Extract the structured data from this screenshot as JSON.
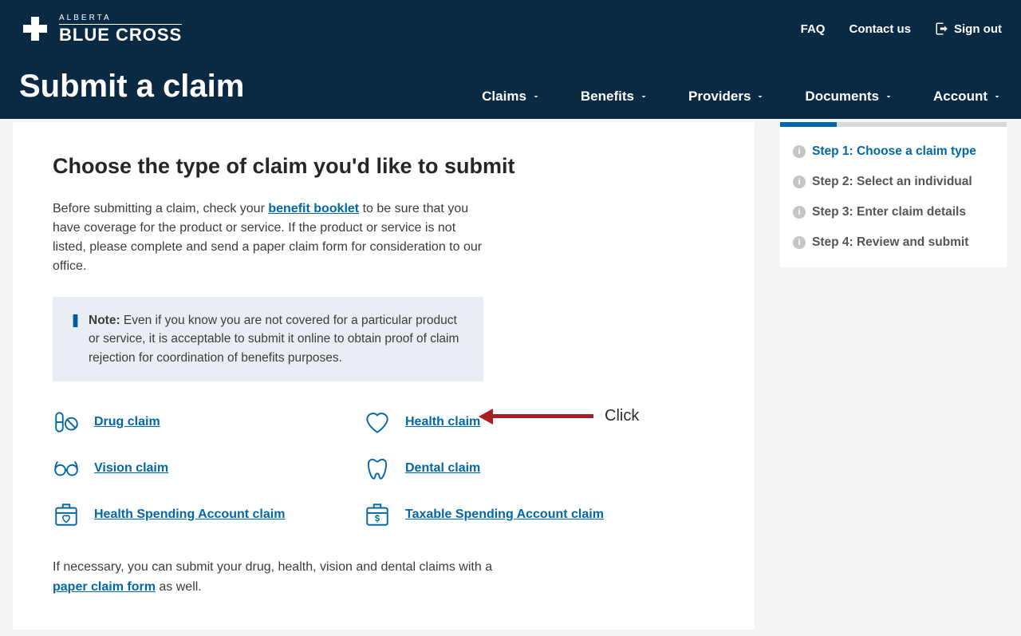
{
  "brand": {
    "alberta": "ALBERTA",
    "blue_cross": "BLUE CROSS"
  },
  "top_links": {
    "faq": "FAQ",
    "contact": "Contact us",
    "sign_out": "Sign out"
  },
  "page_title": "Submit a claim",
  "nav": {
    "claims": "Claims",
    "benefits": "Benefits",
    "providers": "Providers",
    "documents": "Documents",
    "account": "Account"
  },
  "main": {
    "heading": "Choose the type of claim you'd like to submit",
    "intro_pre": "Before submitting a claim, check your ",
    "intro_link": "benefit booklet",
    "intro_post": " to be sure that you have coverage for the product or service. If the product or service is not listed, please complete and send a paper claim form for consideration to our office.",
    "note_label": "Note:",
    "note_body": " Even if you know you are not covered for a particular product or service, it is acceptable to submit it online to obtain proof of claim rejection for coordination of benefits purposes.",
    "outro_pre": "If necessary, you can submit your drug, health, vision and dental claims with a ",
    "outro_link": "paper claim form",
    "outro_post": " as well."
  },
  "claims": {
    "drug": "Drug claim",
    "health": "Health claim",
    "vision": "Vision claim",
    "dental": "Dental claim",
    "hsa": "Health Spending Account claim",
    "tsa": "Taxable Spending Account claim"
  },
  "steps": {
    "s1": "Step 1: Choose a claim type",
    "s2": "Step 2: Select an individual",
    "s3": "Step 3: Enter claim details",
    "s4": "Step 4: Review and submit"
  },
  "annotation": {
    "label": "Click"
  }
}
